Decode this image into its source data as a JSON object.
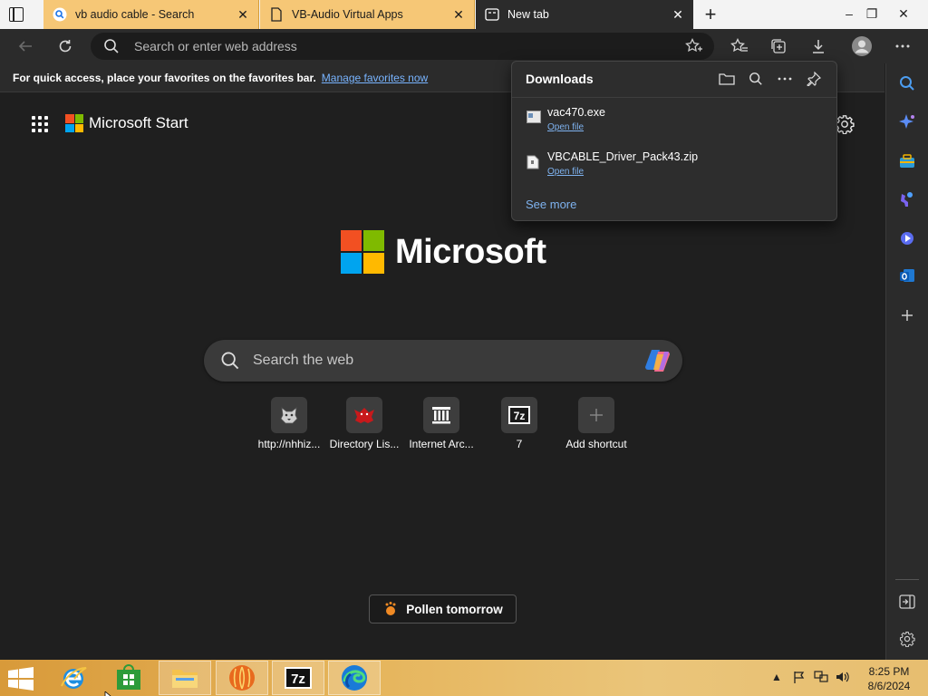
{
  "colors": {
    "accent_link": "#78b4ff",
    "tab_inactive": "#f6c776",
    "content_bg": "#1f1f1f",
    "ms_red": "#f25022",
    "ms_green": "#7fba00",
    "ms_blue": "#00a4ef",
    "ms_yellow": "#ffb900"
  },
  "tabs": [
    {
      "title": "vb audio cable - Search",
      "icon": "search-favicon",
      "active": false
    },
    {
      "title": "VB-Audio Virtual Apps",
      "icon": "page-favicon",
      "active": false
    },
    {
      "title": "New tab",
      "icon": "newtab-favicon",
      "active": true
    }
  ],
  "window_controls": {
    "minimize": "–",
    "restore": "❐",
    "close": "✕"
  },
  "address_bar": {
    "placeholder": "Search or enter web address",
    "value": ""
  },
  "favorites_bar": {
    "message": "For quick access, place your favorites on the favorites bar.",
    "link": "Manage favorites now"
  },
  "new_tab_page": {
    "brand": "Microsoft Start",
    "hero_logo_text": "Microsoft",
    "search_placeholder": "Search the web",
    "shortcuts": [
      {
        "label": "http://nhhiz...",
        "icon": "wolf-icon"
      },
      {
        "label": "Directory Lis...",
        "icon": "red-creature-icon"
      },
      {
        "label": "Internet Arc...",
        "icon": "archive-building-icon"
      },
      {
        "label": "7",
        "icon": "7zip-icon"
      },
      {
        "label": "Add shortcut",
        "icon": "plus-icon"
      }
    ],
    "weather_chip": "Pollen tomorrow"
  },
  "downloads_panel": {
    "title": "Downloads",
    "items": [
      {
        "name": "vac470.exe",
        "action": "Open file",
        "icon": "exe-file-icon"
      },
      {
        "name": "VBCABLE_Driver_Pack43.zip",
        "action": "Open file",
        "icon": "zip-file-icon"
      }
    ],
    "see_more": "See more"
  },
  "taskbar": {
    "apps": [
      "internet-explorer",
      "store",
      "file-explorer",
      "media-player",
      "7zip",
      "edge"
    ],
    "time": "8:25 PM",
    "date": "8/6/2024"
  }
}
